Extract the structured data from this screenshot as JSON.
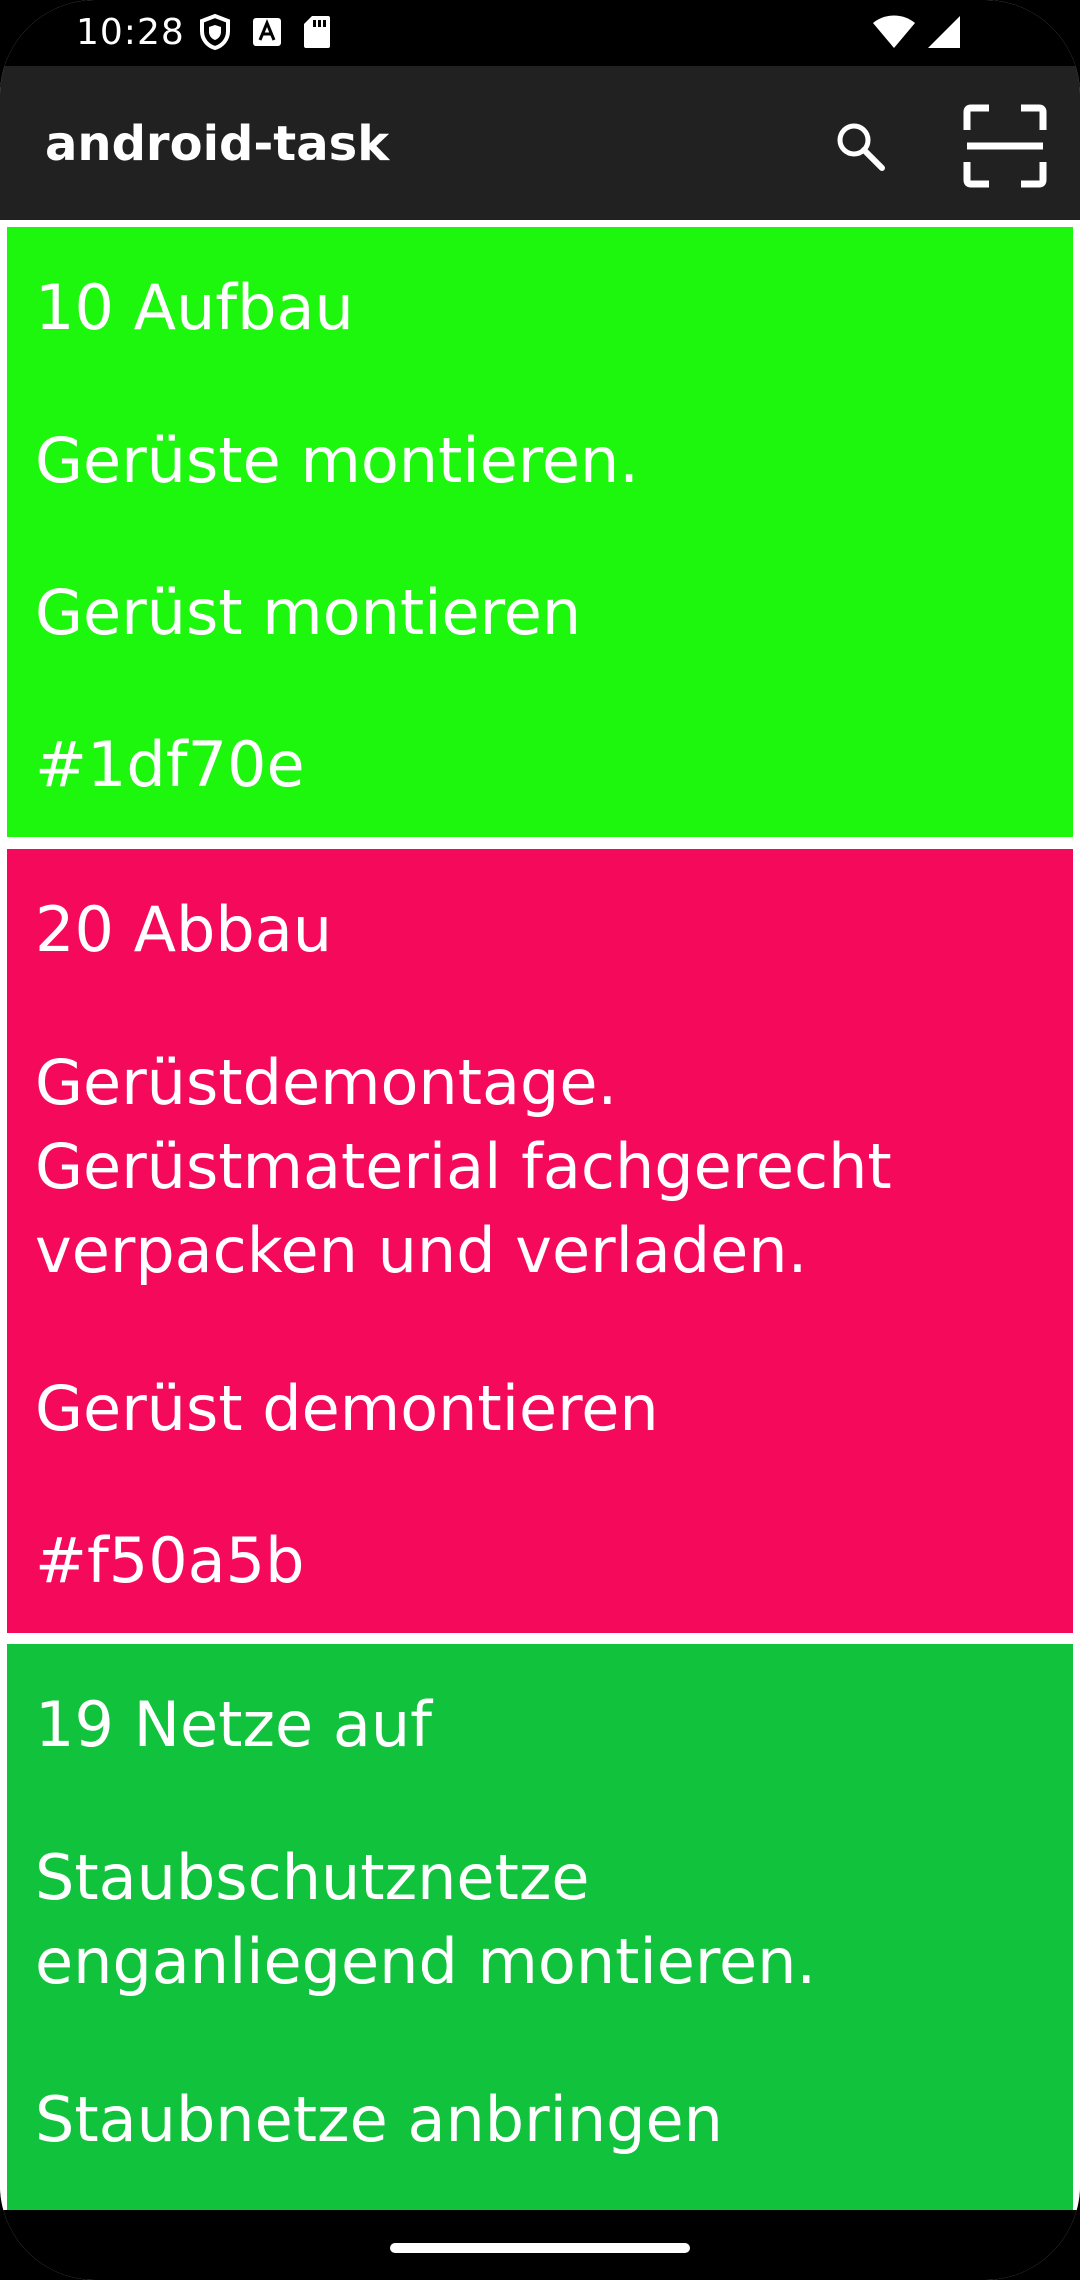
{
  "status_bar": {
    "time": "10:28",
    "icons_left": [
      "shield-icon",
      "a-notification-icon",
      "sd-card-icon"
    ],
    "icons_right": [
      "wifi-icon",
      "cell-signal-icon"
    ]
  },
  "app_bar": {
    "title": "android-task",
    "actions": [
      "search-icon",
      "scan-frame-icon"
    ]
  },
  "tasks": [
    {
      "title": "10 Aufbau",
      "description": "Gerüste montieren.",
      "name": "Gerüst montieren",
      "color": "#1df70e"
    },
    {
      "title": "20 Abbau",
      "description_lines": [
        "Gerüstdemontage.",
        "Gerüstmaterial fachgerecht",
        "verpacken und verladen."
      ],
      "name": "Gerüst demontieren",
      "color": "#f50a5b"
    },
    {
      "title": "19 Netze auf",
      "description_lines": [
        "Staubschutznetze",
        "enganliegend montieren."
      ],
      "name": "Staubnetze anbringen",
      "color": "#11c23d"
    }
  ]
}
